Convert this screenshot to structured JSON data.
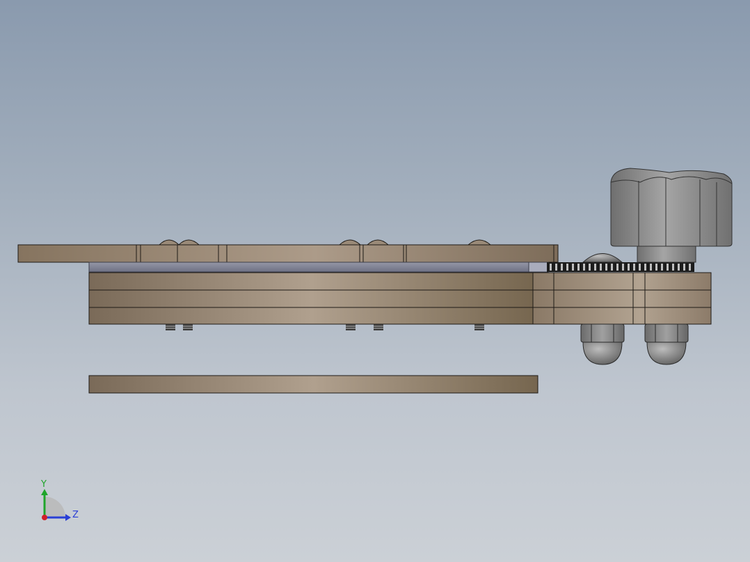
{
  "viewport": {
    "view": "Right",
    "background_top": "#8a9aae",
    "background_bottom": "#cbd0d6"
  },
  "colors": {
    "plate_light": "#ae9f8c",
    "plate_dark": "#7a6a58",
    "spacer_blue": "#7c7f92",
    "hardware_gray": "#7f7f7f",
    "knob_gray": "#8c8c8c",
    "edge_line": "#1e1a16"
  },
  "model": {
    "parts": [
      "top-plate",
      "spacer-layer",
      "base-stack",
      "bottom-plate",
      "adjustment-knob",
      "gear-ring",
      "hex-cap-nut-left",
      "hex-cap-nut-right",
      "button-head-screws"
    ],
    "button_screw_count": 5
  },
  "triad": {
    "y_label": "Y",
    "z_label": "Z",
    "y_color": "#1fa52a",
    "z_color": "#2a3fd6",
    "x_color": "#d0202a",
    "icon": "coordinate-triad-icon"
  }
}
